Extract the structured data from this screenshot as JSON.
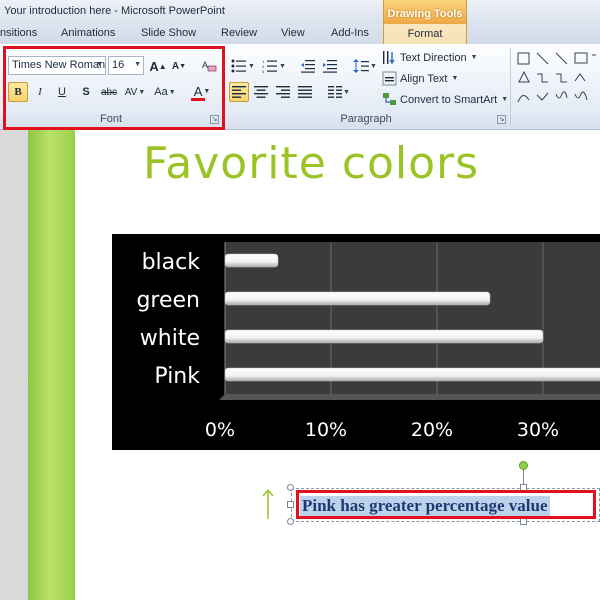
{
  "window": {
    "title": "Your introduction here - Microsoft PowerPoint",
    "context_header": "Drawing Tools"
  },
  "tabs": [
    {
      "label": "nsitions"
    },
    {
      "label": "Animations"
    },
    {
      "label": "Slide Show"
    },
    {
      "label": "Review"
    },
    {
      "label": "View"
    },
    {
      "label": "Add-Ins"
    },
    {
      "label": "Format"
    }
  ],
  "ribbon": {
    "font_group": {
      "label": "Font",
      "font_name": "Times New Roman",
      "font_size": "16",
      "bold": "B",
      "italic": "I",
      "underline": "U",
      "shadow": "S",
      "strike": "abc",
      "spacing": "AV",
      "change_case": "Aa",
      "font_color": "A",
      "grow": "A",
      "shrink": "A"
    },
    "paragraph_group": {
      "label": "Paragraph",
      "text_direction": "Text Direction",
      "align_text": "Align Text",
      "convert_smartart": "Convert to SmartArt"
    }
  },
  "slide": {
    "title": "Favorite colors",
    "text_box": "Pink has greater percentage value"
  },
  "colors": {
    "title_green": "#9bc325",
    "highlight_red": "#e0101e",
    "strip_green": "#8cc63e",
    "text_blue": "#1f3a72"
  },
  "chart_data": {
    "type": "bar",
    "orientation": "horizontal",
    "categories": [
      "black",
      "green",
      "white",
      "Pink"
    ],
    "values": [
      5,
      25,
      30,
      40
    ],
    "x_tick_labels": [
      "0%",
      "10%",
      "20%",
      "30%"
    ],
    "xlim": [
      0,
      35
    ],
    "grid": true
  }
}
